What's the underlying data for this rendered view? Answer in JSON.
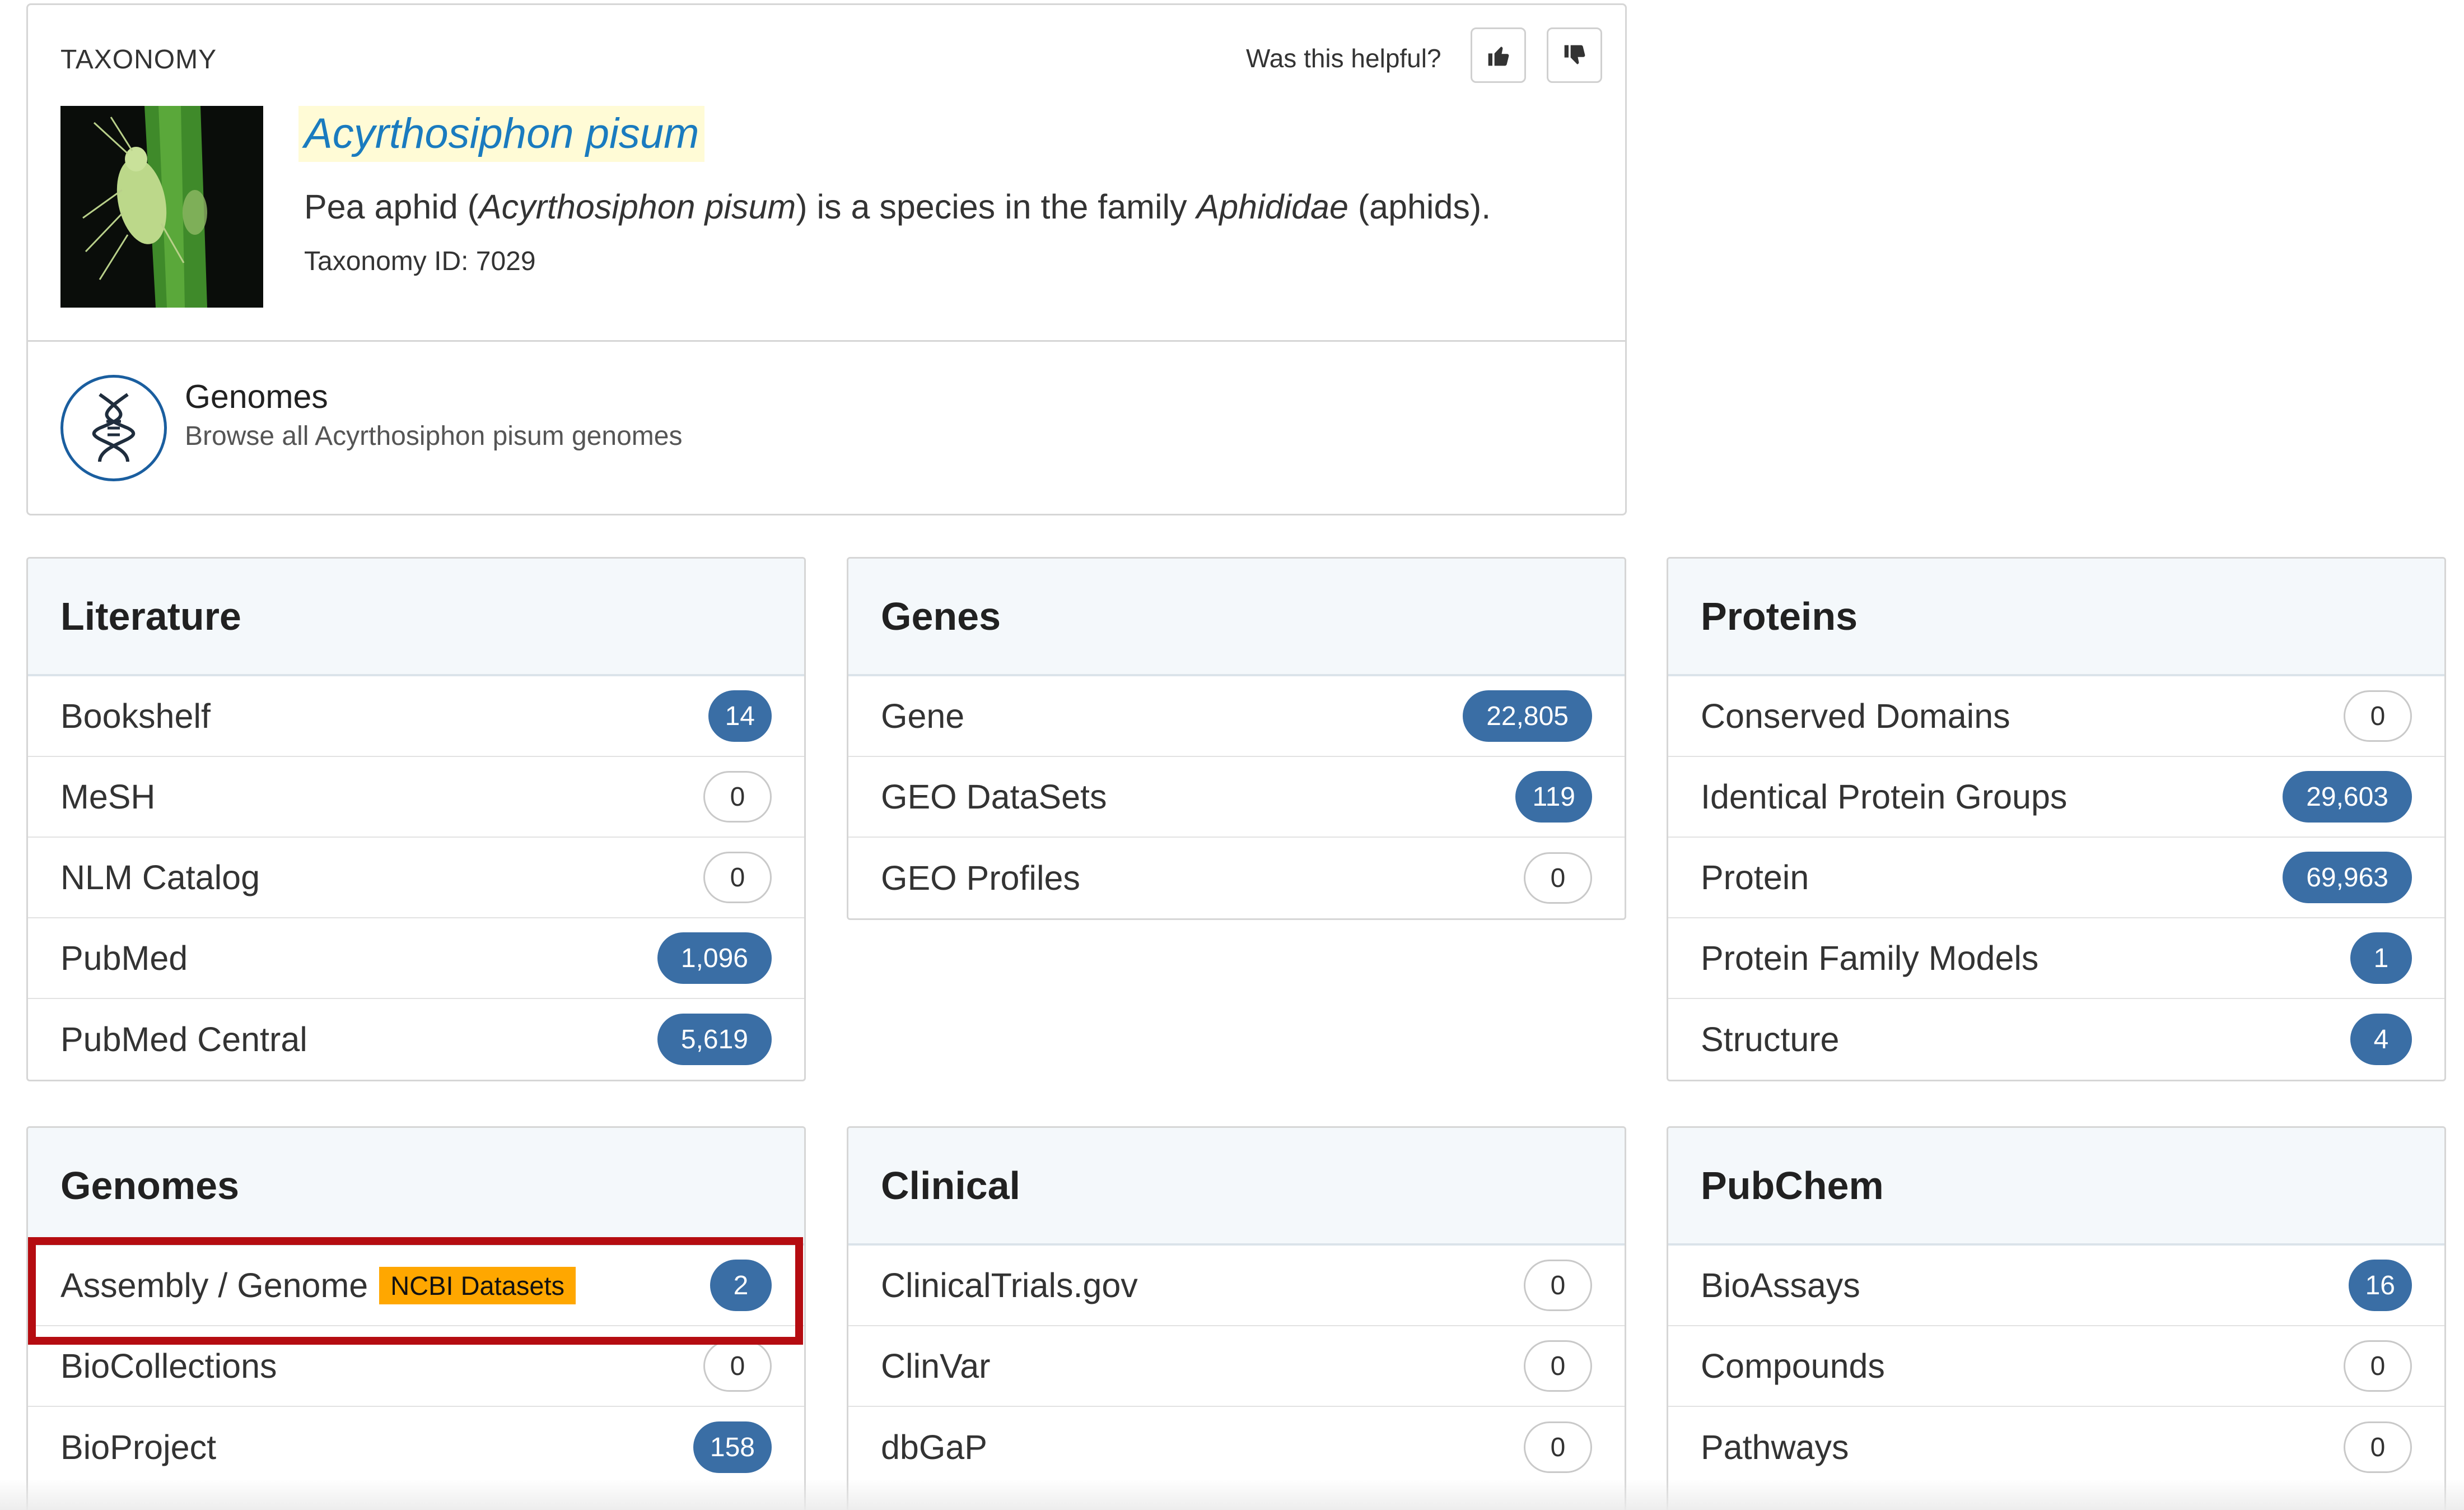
{
  "taxonomy": {
    "section_label": "TAXONOMY",
    "helpful_prompt": "Was this helpful?",
    "name": "Acyrthosiphon pisum",
    "description": {
      "part1": "Pea aphid (",
      "part2": "Acyrthosiphon pisum",
      "part3": ") is a species in the family ",
      "part4": "Aphididae",
      "part5": " (aphids)."
    },
    "taxonomy_id": "Taxonomy ID: 7029",
    "genomes_link": {
      "title": "Genomes",
      "subtitle": "Browse all Acyrthosiphon pisum genomes"
    }
  },
  "panels": {
    "literature": {
      "title": "Literature",
      "rows": [
        {
          "label": "Bookshelf",
          "count": "14"
        },
        {
          "label": "MeSH",
          "count": "0"
        },
        {
          "label": "NLM Catalog",
          "count": "0"
        },
        {
          "label": "PubMed",
          "count": "1,096"
        },
        {
          "label": "PubMed Central",
          "count": "5,619"
        }
      ]
    },
    "genes": {
      "title": "Genes",
      "rows": [
        {
          "label": "Gene",
          "count": "22,805"
        },
        {
          "label": "GEO DataSets",
          "count": "119"
        },
        {
          "label": "GEO Profiles",
          "count": "0"
        }
      ]
    },
    "proteins": {
      "title": "Proteins",
      "rows": [
        {
          "label": "Conserved Domains",
          "count": "0"
        },
        {
          "label": "Identical Protein Groups",
          "count": "29,603"
        },
        {
          "label": "Protein",
          "count": "69,963"
        },
        {
          "label": "Protein Family Models",
          "count": "1"
        },
        {
          "label": "Structure",
          "count": "4"
        }
      ]
    },
    "genomes": {
      "title": "Genomes",
      "rows": [
        {
          "label": "Assembly / Genome",
          "tag": "NCBI Datasets",
          "count": "2"
        },
        {
          "label": "BioCollections",
          "count": "0"
        },
        {
          "label": "BioProject",
          "count": "158"
        }
      ]
    },
    "clinical": {
      "title": "Clinical",
      "rows": [
        {
          "label": "ClinicalTrials.gov",
          "count": "0"
        },
        {
          "label": "ClinVar",
          "count": "0"
        },
        {
          "label": "dbGaP",
          "count": "0"
        }
      ]
    },
    "pubchem": {
      "title": "PubChem",
      "rows": [
        {
          "label": "BioAssays",
          "count": "16"
        },
        {
          "label": "Compounds",
          "count": "0"
        },
        {
          "label": "Pathways",
          "count": "0"
        }
      ]
    }
  },
  "colors": {
    "link_blue": "#1a7bbf",
    "badge_blue": "#3a6ea5",
    "highlight_red": "#b50c11",
    "tag_orange": "#ffa700"
  }
}
